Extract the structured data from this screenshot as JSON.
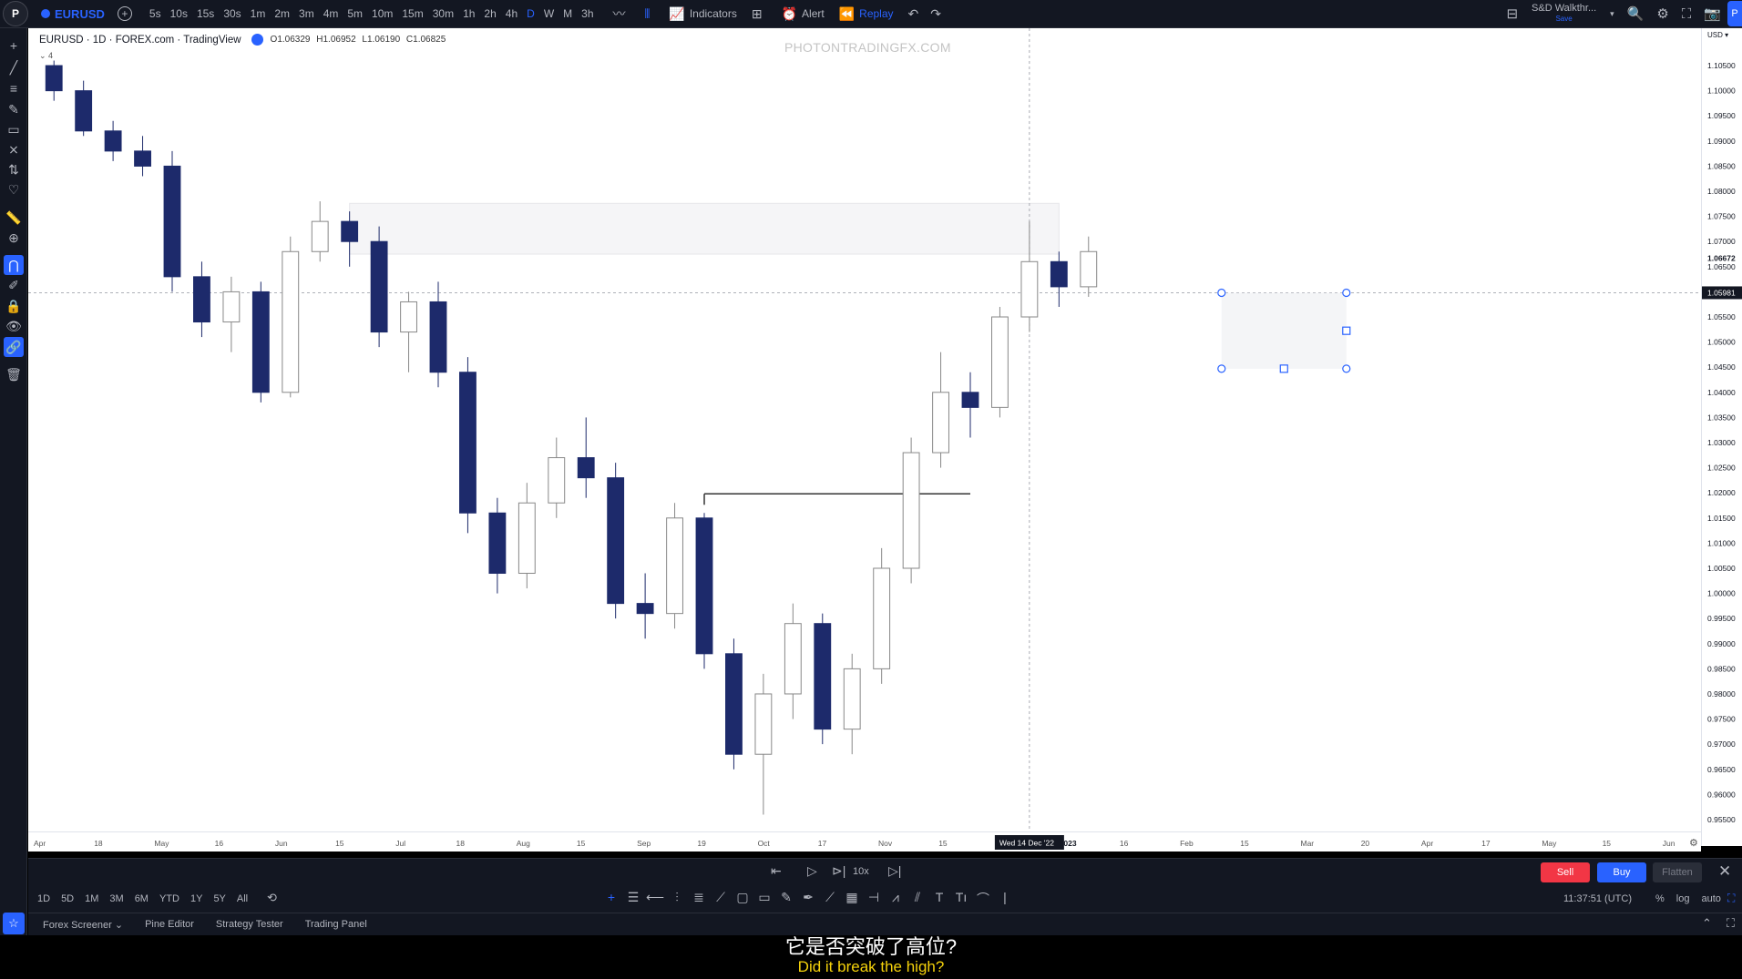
{
  "topbar": {
    "symbol": "EURUSD",
    "intervals": [
      "5s",
      "10s",
      "15s",
      "30s",
      "1m",
      "2m",
      "3m",
      "4m",
      "5m",
      "10m",
      "15m",
      "30m",
      "1h",
      "2h",
      "4h",
      "D",
      "W",
      "M",
      "3h"
    ],
    "active_interval": "D",
    "indicators_label": "Indicators",
    "alert_label": "Alert",
    "replay_label": "Replay",
    "layout_name": "S&D Walkthr...",
    "layout_status": "Save"
  },
  "legend": {
    "title": "EURUSD · 1D · FOREX.com · TradingView",
    "open": "O1.06329",
    "high": "H1.06952",
    "low": "L1.06190",
    "close": "C1.06825",
    "collapse_count": "4"
  },
  "watermark": "PHOTONTRADINGFX.COM",
  "price_axis": {
    "currency": "USD",
    "labels": [
      "1.10500",
      "1.10000",
      "1.09500",
      "1.09000",
      "1.08500",
      "1.08000",
      "1.07500",
      "1.07000",
      "1.06500",
      "1.06000",
      "1.05500",
      "1.05000",
      "1.04500",
      "1.04000",
      "1.03500",
      "1.03000",
      "1.02500",
      "1.02000",
      "1.01500",
      "1.01000",
      "1.00500",
      "1.00000",
      "0.99500",
      "0.99000",
      "0.98500",
      "0.98000",
      "0.97500",
      "0.97000",
      "0.96500",
      "0.96000",
      "0.95500"
    ],
    "last_price": "1.06672",
    "crosshair_price": "1.05981"
  },
  "time_axis": {
    "labels": [
      "Apr",
      "18",
      "May",
      "16",
      "Jun",
      "15",
      "Jul",
      "18",
      "Aug",
      "15",
      "Sep",
      "19",
      "Oct",
      "17",
      "Nov",
      "15",
      "Dec",
      "2023",
      "16",
      "Feb",
      "15",
      "Mar",
      "20",
      "Apr",
      "17",
      "May",
      "15",
      "Jun"
    ],
    "crosshair_date": "Wed 14 Dec '22"
  },
  "replay": {
    "speed": "10x",
    "sell_label": "Sell",
    "buy_label": "Buy",
    "flatten_label": "Flatten"
  },
  "bottom_toolbar": {
    "ranges": [
      "1D",
      "5D",
      "1M",
      "3M",
      "6M",
      "YTD",
      "1Y",
      "5Y",
      "All"
    ],
    "clock": "11:37:51 (UTC)",
    "options": [
      "%",
      "log",
      "auto"
    ]
  },
  "panel_tabs": [
    "Forex Screener",
    "Pine Editor",
    "Strategy Tester",
    "Trading Panel"
  ],
  "subtitles": {
    "zh": "它是否突破了高位?",
    "en": "Did it break the high?"
  },
  "chart_data": {
    "type": "candlestick",
    "symbol": "EURUSD",
    "timeframe": "1D",
    "ylim": [
      0.953,
      1.107
    ],
    "series": [
      {
        "name": "Apr",
        "ohlc": [
          [
            1.105,
            1.106,
            1.098,
            1.1
          ],
          [
            1.1,
            1.102,
            1.091,
            1.092
          ],
          [
            1.092,
            1.094,
            1.086,
            1.088
          ],
          [
            1.088,
            1.091,
            1.083,
            1.085
          ]
        ]
      },
      {
        "name": "May",
        "ohlc": [
          [
            1.085,
            1.088,
            1.06,
            1.063
          ],
          [
            1.063,
            1.066,
            1.051,
            1.054
          ],
          [
            1.054,
            1.063,
            1.048,
            1.06
          ],
          [
            1.06,
            1.062,
            1.038,
            1.04
          ]
        ]
      },
      {
        "name": "Jun",
        "ohlc": [
          [
            1.04,
            1.071,
            1.039,
            1.068
          ],
          [
            1.068,
            1.078,
            1.066,
            1.074
          ],
          [
            1.074,
            1.076,
            1.065,
            1.07
          ],
          [
            1.07,
            1.073,
            1.049,
            1.052
          ]
        ]
      },
      {
        "name": "Jul",
        "ohlc": [
          [
            1.052,
            1.06,
            1.044,
            1.058
          ],
          [
            1.058,
            1.062,
            1.041,
            1.044
          ],
          [
            1.044,
            1.047,
            1.012,
            1.016
          ],
          [
            1.016,
            1.019,
            1.0,
            1.004
          ]
        ]
      },
      {
        "name": "Aug",
        "ohlc": [
          [
            1.004,
            1.022,
            1.001,
            1.018
          ],
          [
            1.018,
            1.031,
            1.015,
            1.027
          ],
          [
            1.027,
            1.035,
            1.019,
            1.023
          ],
          [
            1.023,
            1.026,
            0.995,
            0.998
          ]
        ]
      },
      {
        "name": "Sep",
        "ohlc": [
          [
            0.998,
            1.004,
            0.991,
            0.996
          ],
          [
            0.996,
            1.018,
            0.993,
            1.015
          ],
          [
            1.015,
            1.016,
            0.985,
            0.988
          ],
          [
            0.988,
            0.991,
            0.965,
            0.968
          ]
        ]
      },
      {
        "name": "Oct",
        "ohlc": [
          [
            0.968,
            0.984,
            0.956,
            0.98
          ],
          [
            0.98,
            0.998,
            0.975,
            0.994
          ],
          [
            0.994,
            0.996,
            0.97,
            0.973
          ],
          [
            0.973,
            0.988,
            0.968,
            0.985
          ]
        ]
      },
      {
        "name": "Nov",
        "ohlc": [
          [
            0.985,
            1.009,
            0.982,
            1.005
          ],
          [
            1.005,
            1.031,
            1.002,
            1.028
          ],
          [
            1.028,
            1.048,
            1.025,
            1.04
          ],
          [
            1.04,
            1.044,
            1.031,
            1.037
          ]
        ]
      },
      {
        "name": "Dec",
        "ohlc": [
          [
            1.037,
            1.057,
            1.035,
            1.055
          ],
          [
            1.055,
            1.074,
            1.052,
            1.066
          ],
          [
            1.066,
            1.068,
            1.057,
            1.061
          ],
          [
            1.061,
            1.071,
            1.059,
            1.068
          ]
        ]
      }
    ],
    "annotations": {
      "supply_zone": {
        "price_top": 1.0776,
        "price_bottom": 1.0675,
        "from": "Jun",
        "to": "Dec"
      },
      "reference_high_line": {
        "price": 1.0198,
        "from": "Sep",
        "to": "Nov"
      },
      "crosshair_price_line": 1.05981,
      "selected_rectangle": {
        "price_top": 1.0598,
        "price_bottom": 1.0447
      }
    }
  }
}
